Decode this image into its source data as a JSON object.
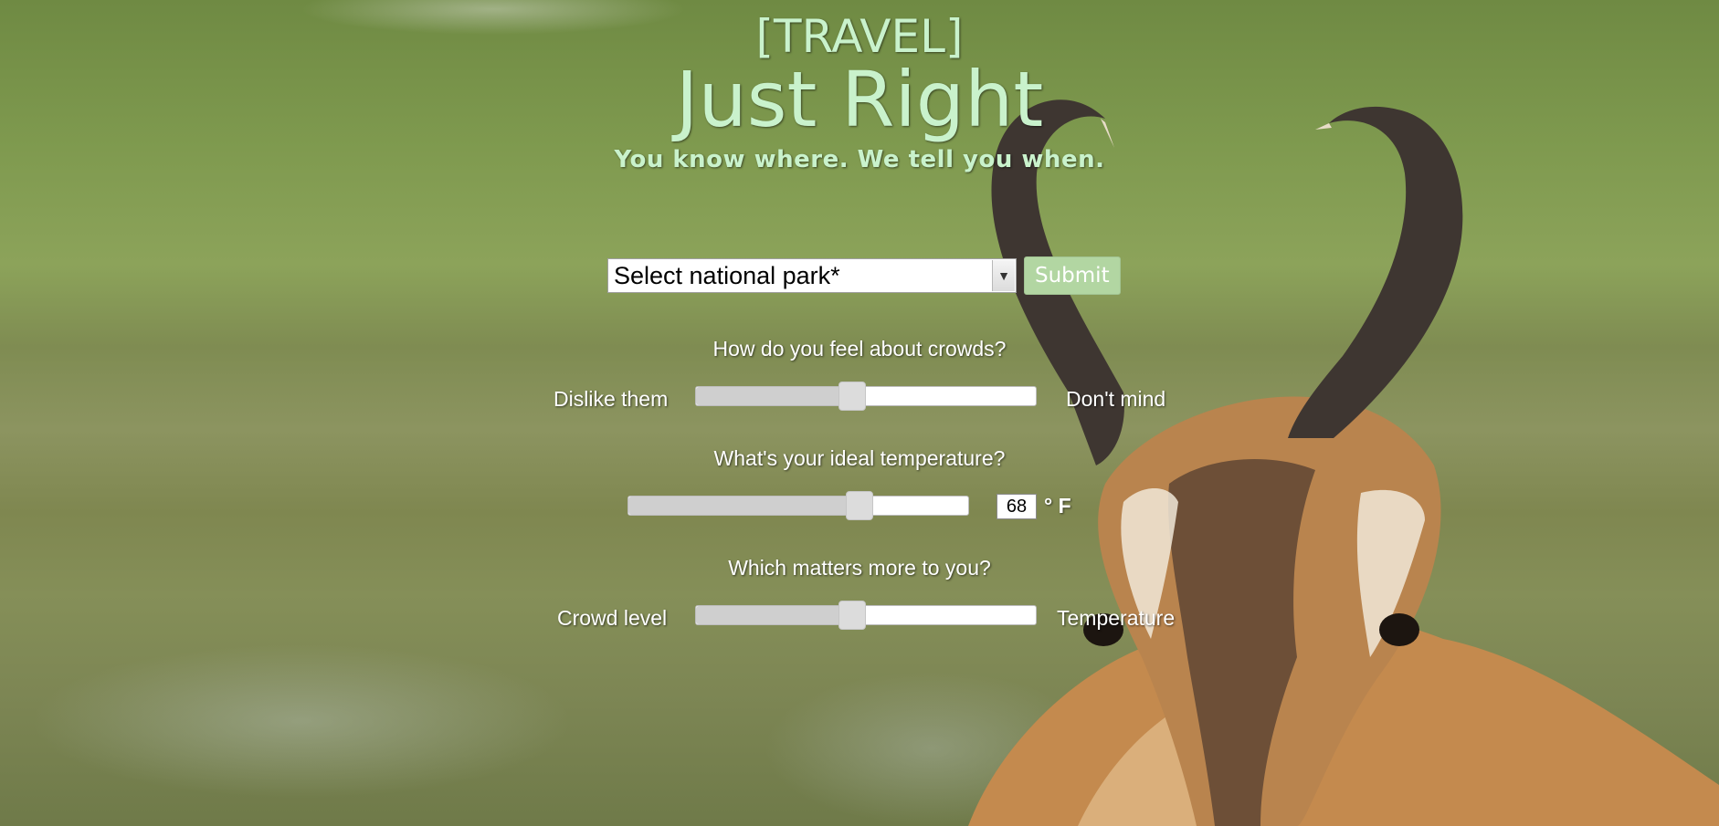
{
  "header": {
    "category": "[TRAVEL]",
    "site_name": "Just Right",
    "tagline": "You know where. We tell you when."
  },
  "park_form": {
    "select_value": "Select national park*",
    "submit_label": "Submit"
  },
  "crowds": {
    "question": "How do you feel about crowds?",
    "left_label": "Dislike them",
    "right_label": "Don't mind",
    "value_fraction": 0.46
  },
  "temperature": {
    "question": "What's your ideal temperature?",
    "value": "68",
    "unit": "° F",
    "value_fraction": 0.68
  },
  "priority": {
    "question": "Which matters more to you?",
    "left_label": "Crowd level",
    "right_label": "Temperature",
    "value_fraction": 0.46
  },
  "colors": {
    "title": "#c9f2cc",
    "submit_bg": "#b2d6a2",
    "background": "#7f9a4f"
  }
}
